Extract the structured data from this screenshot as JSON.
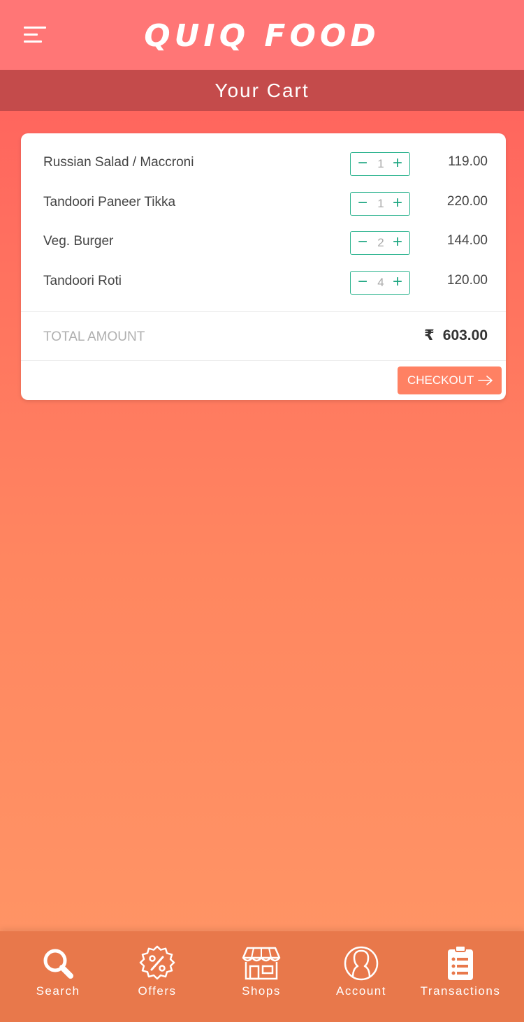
{
  "header": {
    "logo": "QUIQ FOOD",
    "subtitle": "Your Cart"
  },
  "cart": {
    "items": [
      {
        "name": "Russian Salad / Maccroni",
        "qty": "1",
        "price": "119.00"
      },
      {
        "name": "Tandoori Paneer Tikka",
        "qty": "1",
        "price": "220.00"
      },
      {
        "name": "Veg. Burger",
        "qty": "2",
        "price": "144.00"
      },
      {
        "name": "Tandoori Roti",
        "qty": "4",
        "price": "120.00"
      }
    ],
    "stepper": {
      "minus": "−",
      "plus": "+"
    },
    "total_label": "TOTAL AMOUNT",
    "currency": "₹",
    "total_value": "603.00",
    "checkout_label": "CHECKOUT"
  },
  "nav": {
    "items": [
      {
        "label": "Search",
        "icon": "search-icon"
      },
      {
        "label": "Offers",
        "icon": "offers-icon"
      },
      {
        "label": "Shops",
        "icon": "shop-icon"
      },
      {
        "label": "Account",
        "icon": "account-icon"
      },
      {
        "label": "Transactions",
        "icon": "transactions-icon"
      }
    ]
  },
  "colors": {
    "header_bg": "#ff7676",
    "subheader_bg": "#c44b4b",
    "accent": "#2bb38e",
    "checkout_bg": "#ff8163",
    "nav_bg": "#e8784b"
  }
}
